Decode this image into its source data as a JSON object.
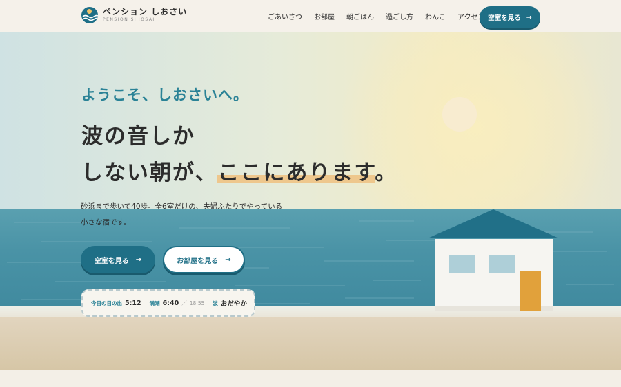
{
  "header": {
    "brand_name": "ペンション しおさい",
    "brand_sub": "PENSION SHIOSAI",
    "nav": [
      "ごあいさつ",
      "お部屋",
      "朝ごはん",
      "過ごし方",
      "わんこ",
      "アクセス"
    ],
    "cta_label": "空室を見る",
    "cta_arrow": "→"
  },
  "hero": {
    "eyebrow": "ようこそ、しおさいへ。",
    "headline_line1": "波の音しか",
    "headline_line2_a": "しない朝が、",
    "headline_line2_highlight": "ここにあります",
    "headline_line2_end": "。",
    "description": "砂浜まで歩いて40歩。全6室だけの、夫婦ふたりでやっている小さな宿です。",
    "primary_button": "空室を見る",
    "secondary_button": "お部屋を見る",
    "arrow": "→"
  },
  "info": {
    "sunrise_label": "今日の日の出",
    "sunrise_value": "5:12",
    "tide_label": "満潮",
    "tide_value": "6:40",
    "tide_sep": "／",
    "tide_second": "18:55",
    "wave_label": "波",
    "wave_value": "おだやか"
  },
  "colors": {
    "accent": "#1f6f86",
    "accent_light": "#2a8296",
    "highlight": "#eec78d",
    "door": "#e1a13b",
    "sea": "#4a93a6"
  },
  "icons": [
    "logo-wave-sun-icon",
    "arrow-right-icon"
  ]
}
